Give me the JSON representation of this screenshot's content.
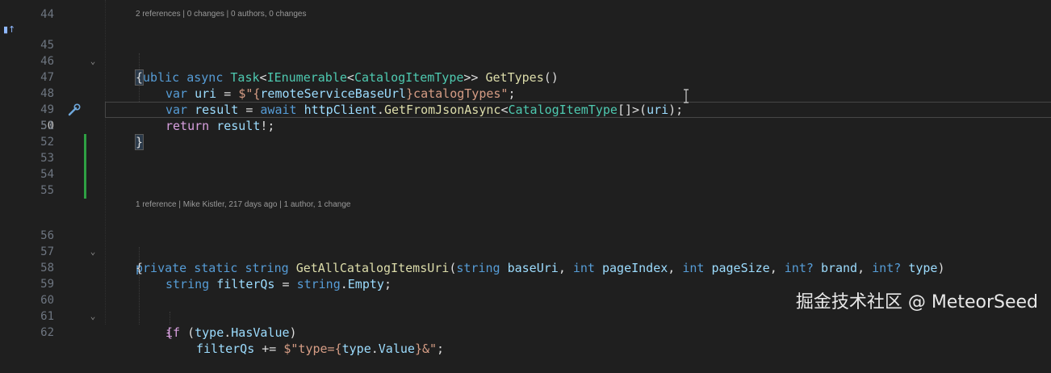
{
  "colors": {
    "background": "#1f1f1f",
    "keyword": "#569cd6",
    "type": "#4ec9b0",
    "method": "#dcdcaa",
    "variable": "#9cdcfe",
    "string": "#d69d85",
    "control": "#d8a0df",
    "change_bar": "#2ea043"
  },
  "gutter": {
    "line_44": "44",
    "lines": [
      "45",
      "46",
      "47",
      "48",
      "49",
      "50",
      "51",
      "52",
      "53",
      "54",
      "55",
      "56",
      "57",
      "58",
      "59",
      "60",
      "61",
      "62"
    ],
    "current_line": "50"
  },
  "code_lens": {
    "get_types": "2 references | 0 changes | 0 authors, 0 changes",
    "get_all_catalog_items_uri": "1 reference | Mike Kistler, 217 days ago | 1 author, 1 change"
  },
  "code": {
    "l45": [
      "public",
      " ",
      "async",
      " ",
      "Task",
      "<",
      "IEnumerable",
      "<",
      "CatalogItemType",
      ">>",
      " ",
      "GetTypes",
      "()"
    ],
    "l46": [
      "{"
    ],
    "l47": [
      "var",
      " ",
      "uri",
      " = ",
      "$\"{",
      "remoteServiceBaseUrl",
      "}catalogTypes\"",
      ";"
    ],
    "l48": [
      "var",
      " ",
      "result",
      " = ",
      "await",
      " ",
      "httpClient",
      ".",
      "GetFromJsonAsync",
      "<",
      "CatalogItemType",
      "[]>(",
      "uri",
      ");"
    ],
    "l49": [
      "return",
      " ",
      "result",
      "!;"
    ],
    "l50": [
      "}"
    ],
    "l56": [
      "private",
      " ",
      "static",
      " ",
      "string",
      " ",
      "GetAllCatalogItemsUri",
      "(",
      "string",
      " ",
      "baseUri",
      ", ",
      "int",
      " ",
      "pageIndex",
      ", ",
      "int",
      " ",
      "pageSize",
      ", ",
      "int?",
      " ",
      "brand",
      ", ",
      "int?",
      " ",
      "type",
      ")"
    ],
    "l57": [
      "{"
    ],
    "l58": [
      "string",
      " ",
      "filterQs",
      " = ",
      "string",
      ".",
      "Empty",
      ";"
    ],
    "l60": [
      "if",
      " (",
      "type",
      ".",
      "HasValue",
      ")"
    ],
    "l61": [
      "{"
    ],
    "l62": [
      "filterQs",
      " += ",
      "$\"type={",
      "type",
      ".",
      "Value",
      "}&\"",
      ";"
    ]
  },
  "icons": {
    "gutter_marker": "breakpoint-arrow-icon",
    "quick_action": "screwdriver-icon",
    "cursor": "text-cursor-icon"
  },
  "gutter_marker_glyph": "▮↑",
  "watermark": "掘金技术社区 @ MeteorSeed"
}
